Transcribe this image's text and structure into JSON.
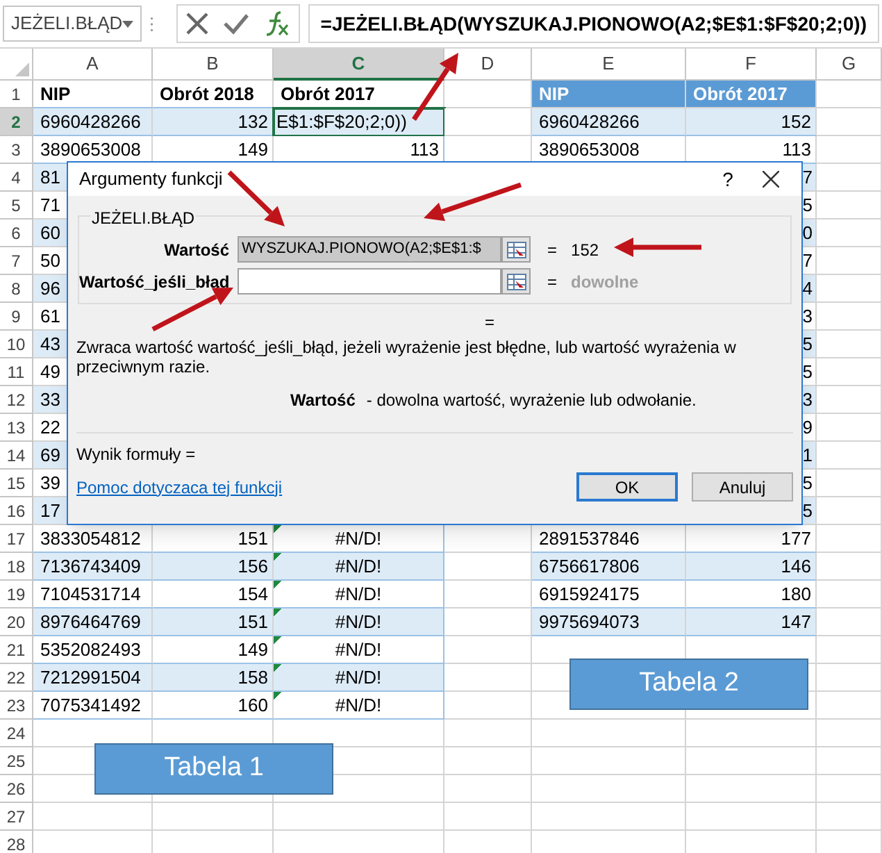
{
  "formula_bar": {
    "name_box": "JEŻELI.BŁĄD",
    "formula": "=JEŻELI.BŁĄD(WYSZUKAJ.PIONOWO(A2;$E$1:$F$20;2;0))"
  },
  "sheet": {
    "columns": [
      {
        "label": "A",
        "selected": false
      },
      {
        "label": "B",
        "selected": false
      },
      {
        "label": "C",
        "selected": true
      },
      {
        "label": "D",
        "selected": false
      },
      {
        "label": "E",
        "selected": false
      },
      {
        "label": "F",
        "selected": false
      },
      {
        "label": "G",
        "selected": false
      }
    ],
    "rows": [
      {
        "number": "1",
        "kind": "header",
        "selected": false,
        "table_1": [
          "NIP",
          "Obrót 2018",
          "Obrót 2017"
        ],
        "table_2": [
          "NIP",
          "Obrót 2017"
        ]
      },
      {
        "number": "2",
        "kind": "data",
        "selected": true,
        "error": false,
        "table_1": [
          "6960428266",
          "132",
          "E$1:$F$20;2;0))"
        ],
        "table_2": [
          "6960428266",
          "152"
        ]
      },
      {
        "number": "3",
        "kind": "data",
        "selected": false,
        "error": false,
        "table_1": [
          "3890653008",
          "149",
          "113"
        ],
        "table_2": [
          "3890653008",
          "113"
        ]
      },
      {
        "number": "4",
        "kind": "covered",
        "selected": false,
        "column_a": "81",
        "column_f": "7"
      },
      {
        "number": "5",
        "kind": "covered",
        "selected": false,
        "column_a": "71",
        "column_f": "5"
      },
      {
        "number": "6",
        "kind": "covered",
        "selected": false,
        "column_a": "60",
        "column_f": "0"
      },
      {
        "number": "7",
        "kind": "covered",
        "selected": false,
        "column_a": "50",
        "column_f": "7"
      },
      {
        "number": "8",
        "kind": "covered",
        "selected": false,
        "column_a": "96",
        "column_f": "4"
      },
      {
        "number": "9",
        "kind": "covered",
        "selected": false,
        "column_a": "61",
        "column_f": "3"
      },
      {
        "number": "10",
        "kind": "covered",
        "selected": false,
        "column_a": "43",
        "column_f": "5"
      },
      {
        "number": "11",
        "kind": "covered",
        "selected": false,
        "column_a": "49",
        "column_f": "5"
      },
      {
        "number": "12",
        "kind": "covered",
        "selected": false,
        "column_a": "33",
        "column_f": "3"
      },
      {
        "number": "13",
        "kind": "covered",
        "selected": false,
        "column_a": "22",
        "column_f": "9"
      },
      {
        "number": "14",
        "kind": "covered",
        "selected": false,
        "column_a": "69",
        "column_f": "1"
      },
      {
        "number": "15",
        "kind": "covered",
        "selected": false,
        "column_a": "39",
        "column_f": "5"
      },
      {
        "number": "16",
        "kind": "covered",
        "selected": false,
        "column_a": "17",
        "column_f": "5"
      },
      {
        "number": "17",
        "kind": "data",
        "selected": false,
        "error": true,
        "table_1": [
          "3833054812",
          "151",
          "#N/D!"
        ],
        "table_2": [
          "2891537846",
          "177"
        ]
      },
      {
        "number": "18",
        "kind": "data",
        "selected": false,
        "error": true,
        "table_1": [
          "7136743409",
          "156",
          "#N/D!"
        ],
        "table_2": [
          "6756617806",
          "146"
        ]
      },
      {
        "number": "19",
        "kind": "data",
        "selected": false,
        "error": true,
        "table_1": [
          "7104531714",
          "154",
          "#N/D!"
        ],
        "table_2": [
          "6915924175",
          "180"
        ]
      },
      {
        "number": "20",
        "kind": "data",
        "selected": false,
        "error": true,
        "table_1": [
          "8976464769",
          "151",
          "#N/D!"
        ],
        "table_2": [
          "9975694073",
          "147"
        ]
      },
      {
        "number": "21",
        "kind": "data",
        "selected": false,
        "error": true,
        "table_1": [
          "5352082493",
          "149",
          "#N/D!"
        ]
      },
      {
        "number": "22",
        "kind": "data",
        "selected": false,
        "error": true,
        "table_1": [
          "7212991504",
          "158",
          "#N/D!"
        ]
      },
      {
        "number": "23",
        "kind": "data",
        "selected": false,
        "error": true,
        "table_1": [
          "7075341492",
          "160",
          "#N/D!"
        ]
      },
      {
        "number": "24",
        "kind": "empty",
        "selected": false
      },
      {
        "number": "25",
        "kind": "empty",
        "selected": false
      },
      {
        "number": "26",
        "kind": "empty",
        "selected": false
      },
      {
        "number": "27",
        "kind": "empty",
        "selected": false
      },
      {
        "number": "28",
        "kind": "empty",
        "selected": false
      }
    ]
  },
  "text_boxes": [
    {
      "label": "Tabela 1"
    },
    {
      "label": "Tabela 2"
    }
  ],
  "dialog": {
    "title": "Argumenty funkcji",
    "help": "?",
    "group_title": "JEŻELI.BŁĄD",
    "arguments": [
      {
        "label": "Wartość",
        "value": "WYSZUKAJ.PIONOWO(A2;$E$1:$",
        "selected": true,
        "equals": "=",
        "result": "152",
        "kind": "value"
      },
      {
        "label": "Wartość_jeśli_błąd",
        "selected": false,
        "equals": "=",
        "result": "dowolne",
        "kind": "hint"
      }
    ],
    "result_equals": "=",
    "description": "Zwraca wartość wartość_jeśli_błąd, jeżeli wyrażenie jest błędne, lub wartość wyrażenia w przeciwnym razie.",
    "param_name": "Wartość",
    "param_text": "- dowolna wartość, wyrażenie lub odwołanie.",
    "formula_result": "Wynik formuły =",
    "help_link": "Pomoc dotyczaca tej funkcji",
    "buttons": [
      {
        "label": "OK",
        "default": true
      },
      {
        "label": "Anuluj",
        "default": false
      }
    ]
  }
}
